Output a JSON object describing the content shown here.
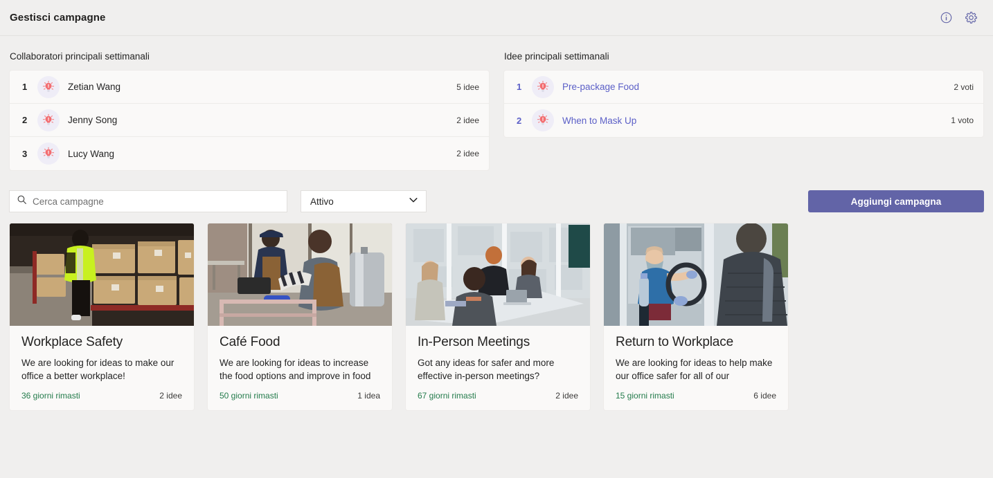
{
  "header": {
    "title": "Gestisci campagne",
    "info_icon": "info-circle-icon",
    "settings_icon": "gear-icon"
  },
  "contributors_panel": {
    "title": "Collaboratori principali settimanali",
    "rows": [
      {
        "rank": "1",
        "icon": "lightbulb-icon",
        "name": "Zetian Wang",
        "count": "5 idee"
      },
      {
        "rank": "2",
        "icon": "lightbulb-icon",
        "name": "Jenny Song",
        "count": "2 idee"
      },
      {
        "rank": "3",
        "icon": "lightbulb-icon",
        "name": "Lucy Wang",
        "count": "2 idee"
      }
    ]
  },
  "ideas_panel": {
    "title": "Idee principali settimanali",
    "rows": [
      {
        "rank": "1",
        "icon": "lightbulb-icon",
        "name": "Pre-package Food",
        "count": "2 voti"
      },
      {
        "rank": "2",
        "icon": "lightbulb-icon",
        "name": "When to Mask Up",
        "count": "1 voto"
      }
    ]
  },
  "toolbar": {
    "search_placeholder": "Cerca campagne",
    "search_value": "",
    "search_icon": "search-icon",
    "status_value": "Attivo",
    "status_chevron": "chevron-down-icon",
    "add_label": "Aggiungi campagna"
  },
  "cards": [
    {
      "title": "Workplace Safety",
      "description": "We are looking for ideas to make our office a better workplace!",
      "days": "36 giorni rimasti",
      "ideas": "2 idee",
      "image": "warehouse-worker-photo"
    },
    {
      "title": "Café Food",
      "description": "We are looking for ideas to increase the food options and improve in food",
      "days": "50 giorni rimasti",
      "ideas": "1 idea",
      "image": "cafe-workers-photo"
    },
    {
      "title": "In-Person Meetings",
      "description": "Got any ideas for safer and more effective in-person meetings?",
      "days": "67 giorni rimasti",
      "ideas": "2 idee",
      "image": "office-meeting-photo"
    },
    {
      "title": "Return to Workplace",
      "description": "We are looking for ideas to help make our office safer for all of our",
      "days": "15 giorni rimasti",
      "ideas": "6 idee",
      "image": "bus-driver-mask-photo"
    }
  ],
  "colors": {
    "accent": "#6264A7",
    "link": "#5B5FC7",
    "success": "#237B4B",
    "page_bg": "#F0EFEE",
    "bulb_pink": "#F4868A"
  }
}
